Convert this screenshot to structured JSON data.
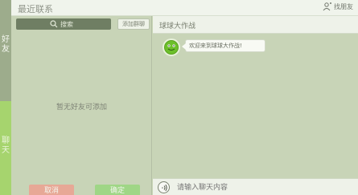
{
  "sidebar": {
    "top_label": "好\n友",
    "bottom_label": "聊\n天"
  },
  "window": {
    "title": "最近联系",
    "find_friend_label": "找朋友"
  },
  "left_panel": {
    "search_placeholder": "搜索",
    "add_group_label": "添加群聊",
    "empty_message": "暂无好友可添加",
    "cancel_label": "取消",
    "confirm_label": "确定"
  },
  "chat": {
    "title": "球球大作战",
    "messages": [
      {
        "avatar": "green-blob-avatar",
        "text": "欢迎来到球球大作战!"
      }
    ],
    "input_placeholder": "请输入聊天内容"
  },
  "colors": {
    "background": "#c9d7b6",
    "accent_green": "#a6d46e",
    "cancel_button": "#e7a896",
    "confirm_button": "#9fd686"
  }
}
